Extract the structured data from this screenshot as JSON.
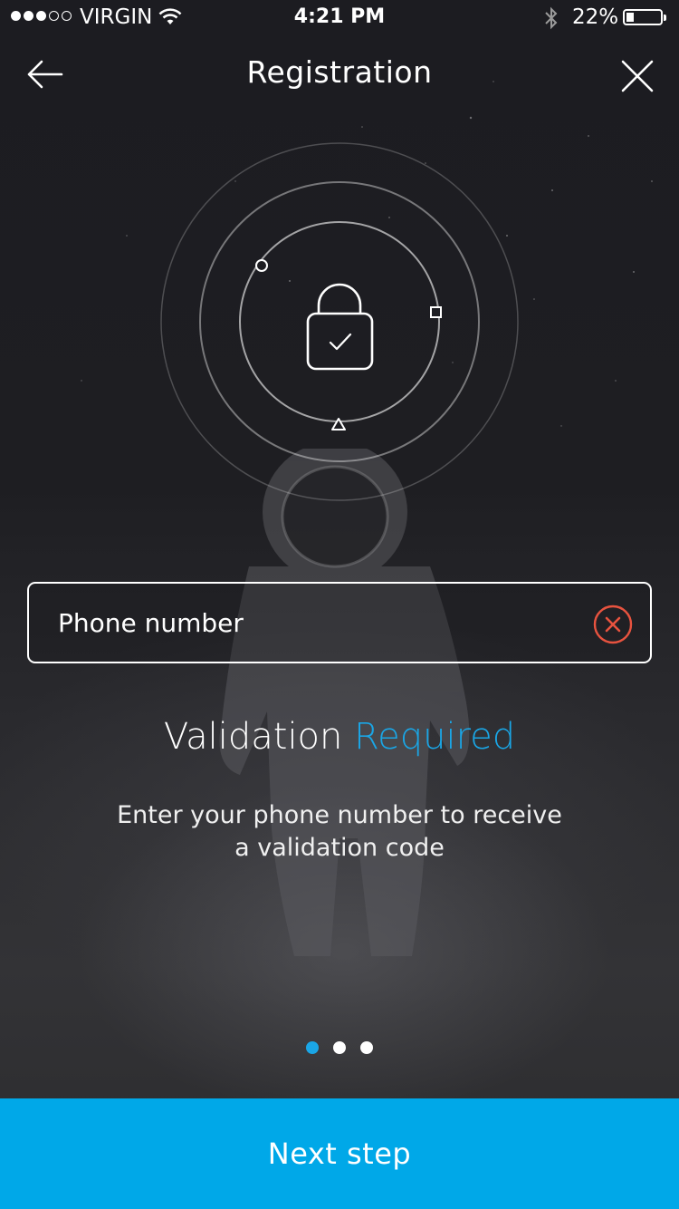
{
  "status_bar": {
    "carrier": "VIRGIN",
    "time": "4:21 PM",
    "battery_percent": "22%",
    "signal_bars_filled": 3,
    "signal_bars_total": 5,
    "battery_level": 0.22
  },
  "nav": {
    "title": "Registration",
    "back_icon": "arrow-left-icon",
    "close_icon": "close-icon"
  },
  "illustration": {
    "icon": "lock-check-icon",
    "orbit_markers": [
      "circle",
      "square",
      "triangle"
    ]
  },
  "phone_field": {
    "placeholder": "Phone number",
    "value": "",
    "clear_icon": "clear-x-icon",
    "error_color": "#e8533f"
  },
  "validation": {
    "title_main": "Validation",
    "title_accent": "Required",
    "helper_line1": "Enter your phone number to receive",
    "helper_line2": "a validation code"
  },
  "pager": {
    "total": 3,
    "active_index": 0
  },
  "next_button": {
    "label": "Next step"
  },
  "colors": {
    "accent": "#1aa6e6",
    "button": "#00a8e8",
    "error": "#e8533f",
    "background": "#1c1c21"
  }
}
